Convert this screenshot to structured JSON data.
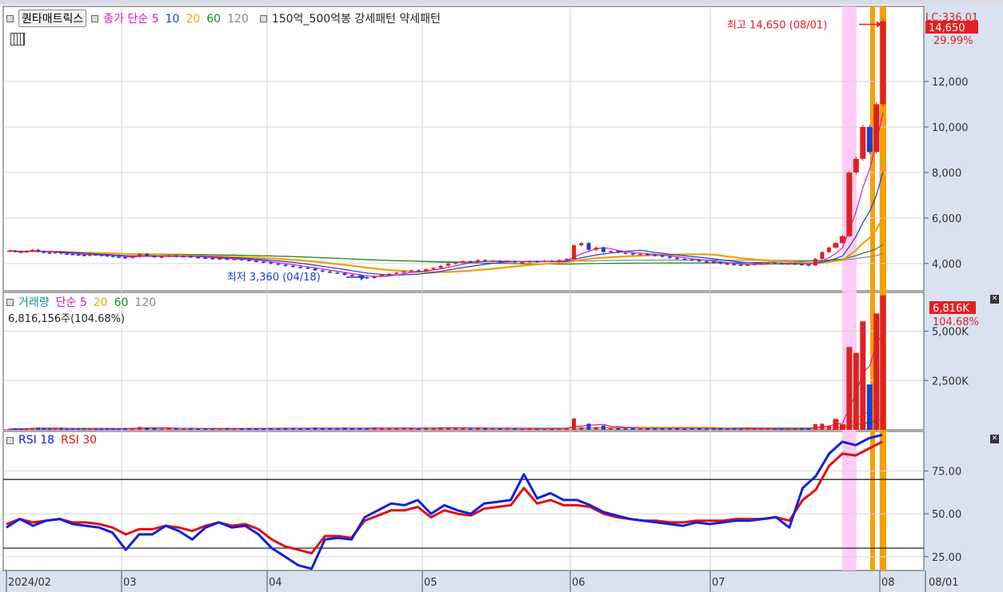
{
  "colors": {
    "up": "#e02020",
    "down": "#1a3fd0",
    "ma5": "#e010c0",
    "ma10": "#1a3fd0",
    "ma20": "#f0a000",
    "ma60": "#1a8a1a",
    "ma120": "#888888",
    "rsi18": "#1020e0",
    "rsi30": "#e01010",
    "highlight_pink": "#ffc8f5",
    "highlight_orange": "#f5a000",
    "axis_bg": "#d8e2f0",
    "price_tag": "#e02020"
  },
  "toolbar": {
    "indicator_button": "퀀타매트릭스",
    "price_legend": [
      {
        "text": "종가 단순 5",
        "color": "#e010c0"
      },
      {
        "text": "10",
        "color": "#1a3fd0"
      },
      {
        "text": "20",
        "color": "#f0a000"
      },
      {
        "text": "60",
        "color": "#1a8a1a"
      },
      {
        "text": "120",
        "color": "#888888"
      }
    ],
    "pattern_legend": "150억_500억봉 강세패턴  약세패턴",
    "grid_icon": "grid-icon"
  },
  "volume_panel": {
    "legend": [
      {
        "text": "거래량",
        "color": "#1a8a9a"
      },
      {
        "text": "단순 5",
        "color": "#e010c0"
      },
      {
        "text": "20",
        "color": "#f0a000"
      },
      {
        "text": "60",
        "color": "#1a8a1a"
      },
      {
        "text": "120",
        "color": "#888888"
      }
    ],
    "info": "6,816,156주(104.68%)",
    "tag_value": "6,816K",
    "tag_pct": "104.68%"
  },
  "rsi_panel": {
    "legend": [
      {
        "text": "RSI 18",
        "color": "#1020e0"
      },
      {
        "text": "RSI 30",
        "color": "#e01010"
      }
    ]
  },
  "annotations": {
    "high": "최고 14,650 (08/01)",
    "low": "최저 3,360 (04/18)",
    "price_tag": "14,650",
    "price_tag_top": "LC:336.01",
    "price_pct": "29.99%"
  },
  "chart_data": [
    {
      "type": "candlestick",
      "x_ticks": [
        "2024/02",
        "03",
        "04",
        "05",
        "06",
        "07",
        "08"
      ],
      "x_end_label": "08/01",
      "y_ticks": [
        "4,000",
        "6,000",
        "8,000",
        "10,000",
        "12,000"
      ],
      "y_tick_values": [
        4000,
        6000,
        8000,
        10000,
        12000
      ],
      "ylim": [
        2800,
        15300
      ],
      "months": [
        {
          "label": "02",
          "close": [
            4560,
            4520,
            4500,
            4540,
            4600,
            4520,
            4480,
            4460,
            4500,
            4440,
            4420,
            4400,
            4380,
            4350,
            4400,
            4380,
            4360,
            4340,
            4300,
            4280
          ]
        },
        {
          "label": "03",
          "close": [
            4250,
            4300,
            4420,
            4330,
            4280,
            4300,
            4350,
            4300,
            4320,
            4280,
            4260,
            4240,
            4200,
            4220,
            4180,
            4200,
            4160,
            4120,
            4080,
            4050
          ]
        },
        {
          "label": "04",
          "close": [
            4000,
            3950,
            3900,
            3850,
            3820,
            3780,
            3700,
            3650,
            3600,
            3580,
            3500,
            3450,
            3400,
            3360,
            3450,
            3500,
            3550,
            3600,
            3650,
            3700,
            3680
          ]
        },
        {
          "label": "05",
          "close": [
            3750,
            3800,
            3900,
            4000,
            4050,
            4100,
            4080,
            4150,
            4100,
            4120,
            4080,
            4100,
            4050,
            4060,
            4100,
            4080,
            4120,
            4100,
            4150,
            4200
          ]
        },
        {
          "label": "06",
          "close": [
            4800,
            4900,
            4600,
            4700,
            4500,
            4550,
            4480,
            4450,
            4400,
            4420,
            4380,
            4350,
            4300,
            4250,
            4200,
            4180,
            4150,
            4100,
            4080
          ]
        },
        {
          "label": "07",
          "close": [
            4050,
            4000,
            3980,
            3950,
            3930,
            3950,
            3980,
            4000,
            4020,
            4010,
            3990,
            4000,
            3980,
            3950,
            3920,
            4200,
            4500,
            4700,
            4900,
            5200,
            8000,
            8600,
            10000,
            8900,
            11000
          ]
        },
        {
          "label": "08",
          "close": [
            14650
          ]
        }
      ],
      "high": {
        "value": 14650,
        "date": "08/01"
      },
      "low": {
        "value": 3360,
        "date": "04/18"
      }
    },
    {
      "type": "bar",
      "title": "거래량",
      "y_ticks": [
        "2,500K",
        "5,000K"
      ],
      "y_tick_values": [
        2500,
        5000
      ],
      "ylim": [
        0,
        6400
      ],
      "volume_k_recent": [
        550,
        280,
        4200,
        3900,
        5500,
        2300,
        5900,
        6816
      ],
      "last_value_k": 6816
    },
    {
      "type": "line",
      "title": "RSI",
      "y_ticks": [
        "25.00",
        "50.00",
        "75.00"
      ],
      "y_tick_values": [
        25,
        50,
        75
      ],
      "ylim": [
        17,
        98
      ],
      "reference_lines": [
        30,
        70
      ],
      "series": [
        {
          "name": "RSI 18",
          "values": [
            42,
            47,
            43,
            46,
            47,
            44,
            43,
            42,
            39,
            29,
            38,
            38,
            43,
            40,
            35,
            42,
            45,
            42,
            43,
            38,
            30,
            25,
            20,
            18,
            35,
            36,
            35,
            48,
            52,
            56,
            55,
            58,
            50,
            55,
            52,
            50,
            56,
            57,
            58,
            73,
            59,
            62,
            58,
            58,
            55,
            51,
            49,
            47,
            46,
            45,
            44,
            43,
            45,
            44,
            45,
            46,
            46,
            47,
            48,
            42,
            65,
            72,
            85,
            92,
            90,
            94,
            96
          ]
        },
        {
          "name": "RSI 30",
          "values": [
            44,
            47,
            45,
            46,
            47,
            45,
            45,
            44,
            42,
            38,
            41,
            41,
            43,
            42,
            40,
            43,
            45,
            43,
            44,
            41,
            35,
            31,
            29,
            27,
            37,
            37,
            36,
            46,
            49,
            52,
            52,
            54,
            48,
            52,
            50,
            49,
            53,
            54,
            55,
            65,
            56,
            58,
            55,
            55,
            54,
            50,
            48,
            47,
            46,
            46,
            45,
            45,
            46,
            46,
            46,
            47,
            47,
            47,
            48,
            46,
            58,
            64,
            78,
            85,
            84,
            88,
            92
          ]
        }
      ]
    }
  ]
}
